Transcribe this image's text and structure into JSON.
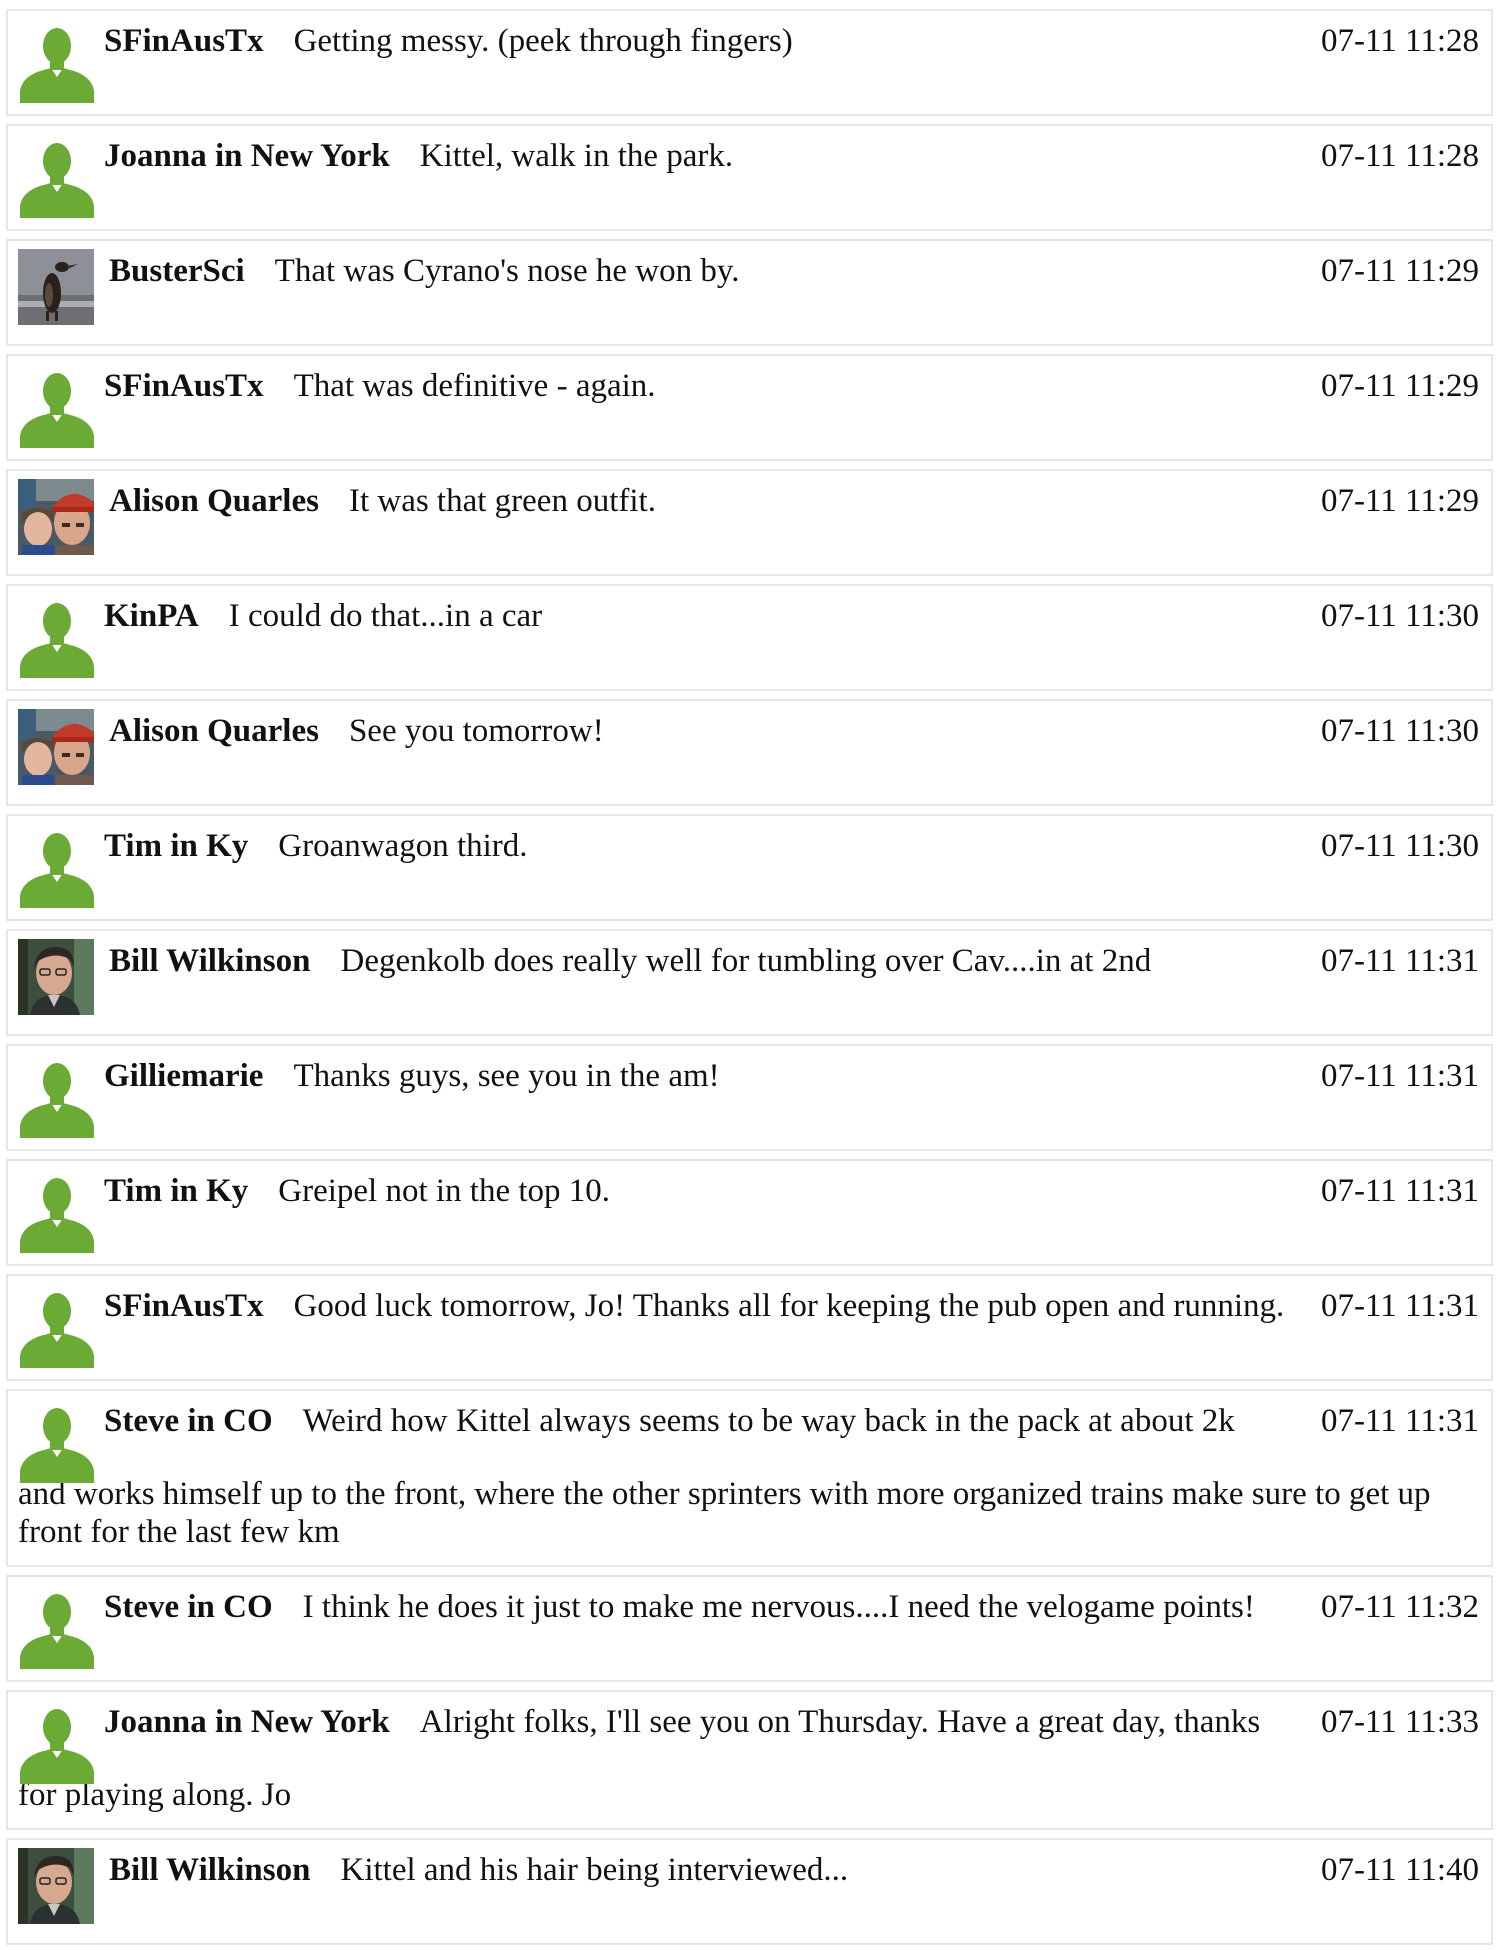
{
  "messages": [
    {
      "user": "SFinAusTx",
      "text": "Getting messy. (peek through fingers)",
      "time": "07-11 11:28",
      "avatar": "default-user-icon"
    },
    {
      "user": "Joanna in New York",
      "text": "Kittel, walk in the park.",
      "time": "07-11 11:28",
      "avatar": "default-user-icon"
    },
    {
      "user": "BusterSci",
      "text": "That was Cyrano's nose he won by.",
      "time": "07-11 11:29",
      "avatar": "penguin-photo"
    },
    {
      "user": "SFinAusTx",
      "text": "That was definitive - again.",
      "time": "07-11 11:29",
      "avatar": "default-user-icon"
    },
    {
      "user": "Alison Quarles",
      "text": "It was that green outfit.",
      "time": "07-11 11:29",
      "avatar": "couple-photo"
    },
    {
      "user": "KinPA",
      "text": "I could do that...in a car",
      "time": "07-11 11:30",
      "avatar": "default-user-icon"
    },
    {
      "user": "Alison Quarles",
      "text": "See you tomorrow!",
      "time": "07-11 11:30",
      "avatar": "couple-photo"
    },
    {
      "user": "Tim in Ky",
      "text": "Groanwagon third.",
      "time": "07-11 11:30",
      "avatar": "default-user-icon"
    },
    {
      "user": "Bill Wilkinson",
      "text": "Degenkolb does really well for tumbling over Cav....in at 2nd",
      "time": "07-11 11:31",
      "avatar": "man-photo"
    },
    {
      "user": "Gilliemarie",
      "text": "Thanks guys, see you in the am!",
      "time": "07-11 11:31",
      "avatar": "default-user-icon"
    },
    {
      "user": "Tim in Ky",
      "text": "Greipel not in the top 10.",
      "time": "07-11 11:31",
      "avatar": "default-user-icon"
    },
    {
      "user": "SFinAusTx",
      "text": "Good luck tomorrow, Jo! Thanks all for keeping the pub open and running.",
      "time": "07-11 11:31",
      "avatar": "default-user-icon"
    },
    {
      "user": "Steve in CO",
      "text": "Weird how Kittel always seems to be way back in the pack at about 2k",
      "continuation": "and works himself up to the front, where the other sprinters with more organized trains make sure to get up front for the last few km",
      "time": "07-11 11:31",
      "avatar": "default-user-icon"
    },
    {
      "user": "Steve in CO",
      "text": "I think he does it just to make me nervous....I need the velogame points!",
      "time": "07-11 11:32",
      "avatar": "default-user-icon"
    },
    {
      "user": "Joanna in New York",
      "text": "Alright folks, I'll see you on Thursday. Have a great day, thanks",
      "continuation": "for playing along. Jo",
      "time": "07-11 11:33",
      "avatar": "default-user-icon"
    },
    {
      "user": "Bill Wilkinson",
      "text": "Kittel and his hair being interviewed...",
      "time": "07-11 11:40",
      "avatar": "man-photo"
    }
  ],
  "colors": {
    "default_avatar": "#6aaa35",
    "border": "#e6e6e6"
  }
}
